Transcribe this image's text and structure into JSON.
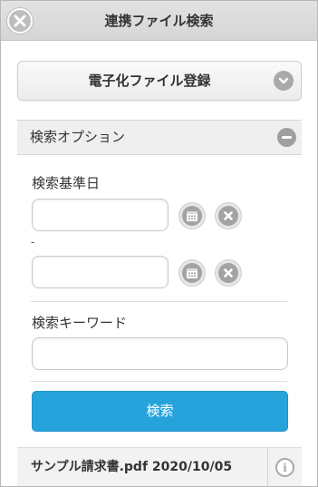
{
  "header": {
    "title": "連携ファイル検索",
    "close_icon": "close-icon"
  },
  "file_type_select": {
    "selected": "電子化ファイル登録",
    "icon": "chevron-down-icon"
  },
  "search_options": {
    "title": "検索オプション",
    "toggle_icon": "minus-icon",
    "base_date": {
      "label": "検索基準日",
      "from_value": "",
      "to_value": "",
      "range_separator": "-",
      "calendar_icon": "calendar-icon",
      "clear_icon": "clear-icon"
    },
    "keyword": {
      "label": "検索キーワード",
      "value": ""
    },
    "search_button": "検索"
  },
  "results": [
    {
      "text": "サンプル請求書.pdf 2020/10/05",
      "icon": "info-icon"
    }
  ],
  "colors": {
    "accent": "#27a3dc",
    "header_bg": "#dcdcdc",
    "icon_gray": "#a3a3a3"
  }
}
